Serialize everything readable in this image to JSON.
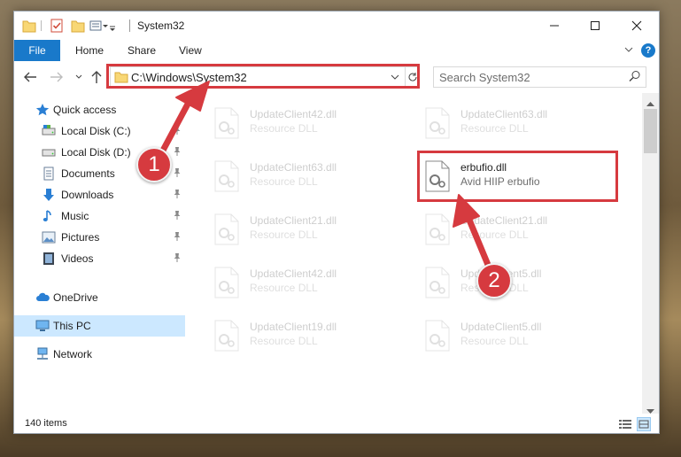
{
  "window": {
    "title": "System32"
  },
  "ribbon": {
    "file_tab": "File",
    "tabs": [
      "Home",
      "Share",
      "View"
    ],
    "help": "?"
  },
  "address": {
    "path": "C:\\Windows\\System32"
  },
  "search": {
    "placeholder": "Search System32"
  },
  "navpane": {
    "items": [
      {
        "label": "Quick access",
        "icon": "star-icon"
      },
      {
        "label": "Local Disk (C:)",
        "icon": "drive-icon"
      },
      {
        "label": "Local Disk (D:)",
        "icon": "drive-icon"
      },
      {
        "label": "Documents",
        "icon": "documents-icon"
      },
      {
        "label": "Downloads",
        "icon": "download-icon"
      },
      {
        "label": "Music",
        "icon": "music-icon"
      },
      {
        "label": "Pictures",
        "icon": "pictures-icon"
      },
      {
        "label": "Videos",
        "icon": "videos-icon"
      },
      {
        "label": "OneDrive",
        "icon": "cloud-icon"
      },
      {
        "label": "This PC",
        "icon": "computer-icon"
      },
      {
        "label": "Network",
        "icon": "network-icon"
      }
    ]
  },
  "files": {
    "left": [
      {
        "name": "UpdateClient42.dll",
        "type": "Resource DLL"
      },
      {
        "name": "UpdateClient63.dll",
        "type": "Resource DLL"
      },
      {
        "name": "UpdateClient21.dll",
        "type": "Resource DLL"
      },
      {
        "name": "UpdateClient42.dll",
        "type": "Resource DLL"
      },
      {
        "name": "UpdateClient19.dll",
        "type": "Resource DLL"
      }
    ],
    "right": [
      {
        "name": "UpdateClient63.dll",
        "type": "Resource DLL"
      },
      {
        "name": "erbufio.dll",
        "type": "Avid HIIP erbufio"
      },
      {
        "name": "UpdateClient21.dll",
        "type": "Resource DLL"
      },
      {
        "name": "UpdateClient5.dll",
        "type": "Resource DLL"
      },
      {
        "name": "UpdateClient5.dll",
        "type": "Resource DLL"
      }
    ]
  },
  "status": {
    "items_count": "140 items"
  },
  "annotations": {
    "badge1": "1",
    "badge2": "2",
    "color": "#d63a3f"
  },
  "colors": {
    "accent": "#1979ca",
    "selected_bg": "#cce8ff"
  }
}
